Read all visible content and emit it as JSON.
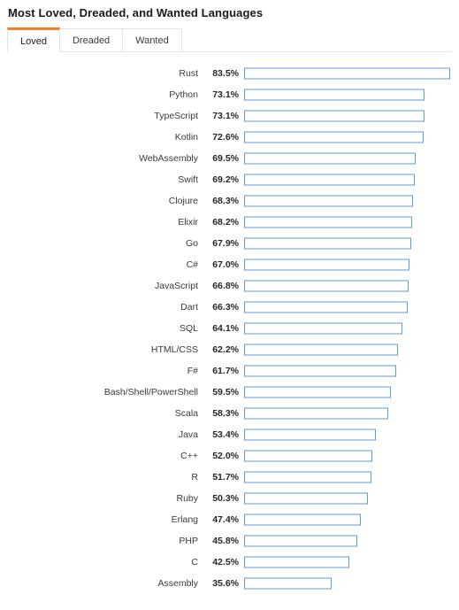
{
  "header": {
    "title": "Most Loved, Dreaded, and Wanted Languages"
  },
  "tabs": {
    "active": "Loved",
    "items": [
      {
        "label": "Loved"
      },
      {
        "label": "Dreaded"
      },
      {
        "label": "Wanted"
      }
    ]
  },
  "colors": {
    "accent": "#f48024",
    "bar_stroke": "#5b9bd5",
    "bar_fill": "#ffffff",
    "rule": "#e4e4e4"
  },
  "chart_data": {
    "type": "bar",
    "orientation": "horizontal",
    "title": "Most Loved, Dreaded, and Wanted Languages",
    "subtitle": "Loved",
    "xlabel": "",
    "ylabel": "",
    "xlim": [
      0,
      90
    ],
    "grid": false,
    "legend": "none",
    "value_suffix": "%",
    "categories": [
      "Rust",
      "Python",
      "TypeScript",
      "Kotlin",
      "WebAssembly",
      "Swift",
      "Clojure",
      "Elixir",
      "Go",
      "C#",
      "JavaScript",
      "Dart",
      "SQL",
      "HTML/CSS",
      "F#",
      "Bash/Shell/PowerShell",
      "Scala",
      "Java",
      "C++",
      "R",
      "Ruby",
      "Erlang",
      "PHP",
      "C",
      "Assembly"
    ],
    "values": [
      83.5,
      73.1,
      73.1,
      72.6,
      69.5,
      69.2,
      68.3,
      68.2,
      67.9,
      67.0,
      66.8,
      66.3,
      64.1,
      62.2,
      61.7,
      59.5,
      58.3,
      53.4,
      52.0,
      51.7,
      50.3,
      47.4,
      45.8,
      42.5,
      35.6
    ],
    "value_labels": [
      "83.5%",
      "73.1%",
      "73.1%",
      "72.6%",
      "69.5%",
      "69.2%",
      "68.3%",
      "68.2%",
      "67.9%",
      "67.0%",
      "66.8%",
      "66.3%",
      "64.1%",
      "62.2%",
      "61.7%",
      "59.5%",
      "58.3%",
      "53.4%",
      "52.0%",
      "51.7%",
      "50.3%",
      "47.4%",
      "45.8%",
      "42.5%",
      "35.6%"
    ]
  }
}
